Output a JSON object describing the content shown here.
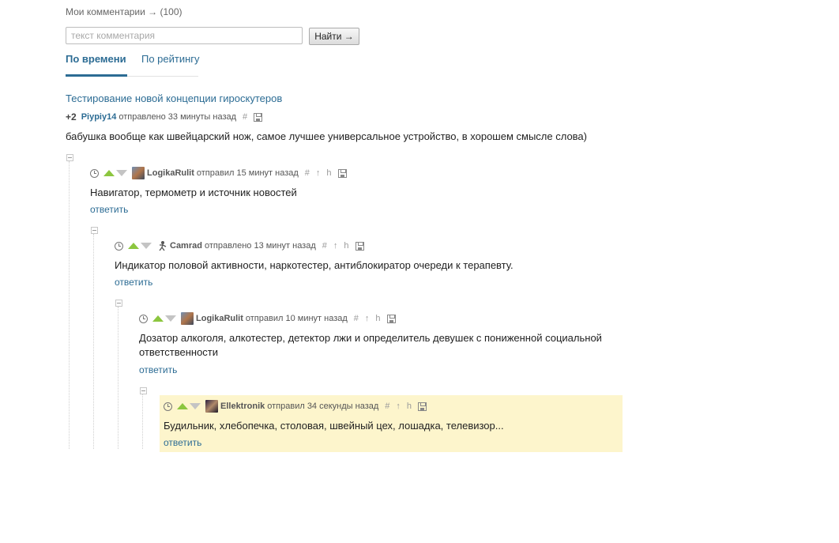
{
  "header": {
    "cut_text": "Мои комментарии  →  (100)"
  },
  "search": {
    "placeholder": "текст комментария",
    "button_label": "Найти →"
  },
  "tabs": [
    {
      "label": "По времени",
      "active": true
    },
    {
      "label": "По рейтингу",
      "active": false
    }
  ],
  "post": {
    "title": "Тестирование новой концепции гироскутеров",
    "score": "+2",
    "author": "Piypiy14",
    "time": "отправлено 33 минуты назад",
    "text": "бабушка вообще как швейцарский нож, самое лучшее универсальное устройство, в хорошем смысле слова)"
  },
  "comments": [
    {
      "author": "LogikaRulit",
      "time": "отправил 15 минут назад",
      "text": "Навигатор, термометр и источник новостей",
      "reply": "ответить"
    },
    {
      "author": "Camrad",
      "time": "отправлено 13 минут назад",
      "text": "Индикатор половой активности, наркотестер, антиблокиратор очереди к терапевту.",
      "reply": "ответить"
    },
    {
      "author": "LogikaRulit",
      "time": "отправил 10 минут назад",
      "text_line1": "Дозатор алкоголя, алкотестер, детектор лжи и определитель девушек с пониженной социальной",
      "text_line2": "ответственности",
      "reply": "ответить"
    },
    {
      "author": "Ellektronik",
      "time": "отправил 34 секунды назад",
      "text": "Будильник, хлебопечка, столовая, швейный цех, лошадка, телевизор...",
      "reply": "ответить",
      "highlighted": true
    }
  ],
  "icons": {
    "hash": "#",
    "parent": "↑",
    "branch": "h",
    "accent_color": "#2c6c94",
    "upvote_color": "#8cc63f",
    "highlight_color": "#fdf5cc"
  }
}
